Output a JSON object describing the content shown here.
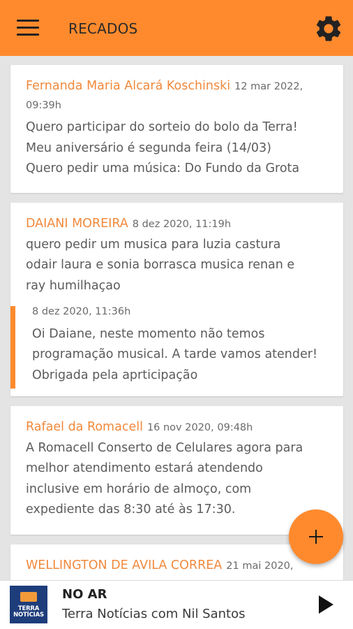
{
  "app": {
    "title": "RECADOS",
    "menu_icon": "menu-icon",
    "settings_icon": "gear-icon",
    "accent_color": "#ff8a2d"
  },
  "messages": [
    {
      "lines": [
        "Quero participar do sorteio do bolo da Terra!",
        "Meu aniversário é segunda feira (14/03)",
        "Quero pedir uma música: Do Fundo da Grota"
      ],
      "author": "Fernanda Maria Alcará Koschinski",
      "date_part1": "12 mar 2022,",
      "date_part2": "09:39h"
    },
    {
      "author": "DAIANI MOREIRA",
      "date": "8 dez 2020, 11:19h",
      "lines": [
        "quero pedir um musica para luzia castura",
        "odair laura e sonia borrasca  musica renan e",
        "ray  humilhaçao"
      ],
      "reply": {
        "date": "8 dez 2020, 11:36h",
        "lines": [
          "Oi Daiane, neste momento não temos",
          "programação musical. A tarde vamos atender!",
          "Obrigada pela aprticipação"
        ]
      }
    },
    {
      "author": "Rafael da Romacell",
      "date": "16 nov 2020, 09:48h",
      "lines": [
        "A Romacell Conserto de Celulares agora para",
        "melhor atendimento estará atendendo",
        "inclusive em horário de almoço, com",
        "expediente das 8:30 até às 17:30."
      ]
    },
    {
      "author": "WELLINGTON DE AVILA CORREA",
      "date": "21 mai 2020,"
    }
  ],
  "fab": {
    "icon": "plus-icon"
  },
  "player": {
    "logo_line1": "TERRA",
    "logo_line2": "NOTÍCIAS",
    "status": "NO AR",
    "program": "Terra Notícias com Nil Santos",
    "play_icon": "play-icon"
  }
}
